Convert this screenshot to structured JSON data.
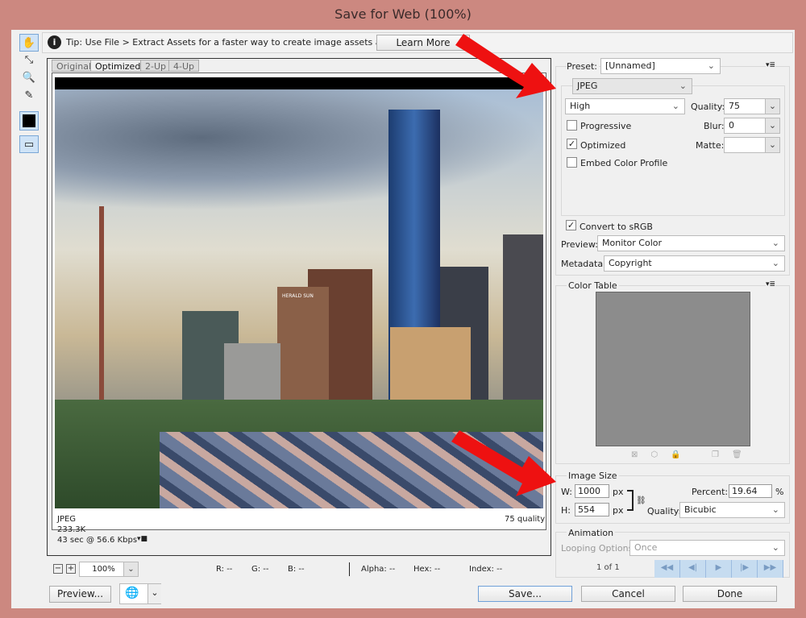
{
  "window": {
    "title": "Save for Web (100%)"
  },
  "tools": [
    {
      "name": "hand-tool",
      "glyph": "✋"
    },
    {
      "name": "slice-select-tool",
      "glyph": "⤡"
    },
    {
      "name": "zoom-tool",
      "glyph": "🔍"
    },
    {
      "name": "eyedropper-tool",
      "glyph": "✎"
    }
  ],
  "tip": {
    "text": "Tip: Use File > Extract Assets for a faster way to create image assets and SVG",
    "learn_more": "Learn More"
  },
  "tabs": [
    "Original",
    "Optimized",
    "2-Up",
    "4-Up"
  ],
  "active_tab": "Optimized",
  "preview_info": {
    "format": "JPEG",
    "size": "233.3K",
    "time": "43 sec @ 56.6 Kbps",
    "quality": "75 quality"
  },
  "photo_text": {
    "sign": "HERALD SUN"
  },
  "zoom": {
    "value": "100%"
  },
  "readout": {
    "r": "R: --",
    "g": "G: --",
    "b": "B: --",
    "alpha": "Alpha: --",
    "hex": "Hex: --",
    "index": "Index: --"
  },
  "settings": {
    "preset_label": "Preset:",
    "preset": "[Unnamed]",
    "format": "JPEG",
    "compression": "High",
    "quality_label": "Quality:",
    "quality": "75",
    "blur_label": "Blur:",
    "blur": "0",
    "matte_label": "Matte:",
    "matte": "",
    "progressive": {
      "label": "Progressive",
      "checked": false
    },
    "optimized": {
      "label": "Optimized",
      "checked": true
    },
    "embed_profile": {
      "label": "Embed Color Profile",
      "checked": false
    },
    "convert_srgb": {
      "label": "Convert to sRGB",
      "checked": true
    },
    "preview_label": "Preview:",
    "preview": "Monitor Color",
    "metadata_label": "Metadata:",
    "metadata": "Copyright"
  },
  "color_table": {
    "title": "Color Table"
  },
  "image_size": {
    "title": "Image Size",
    "w_label": "W:",
    "width": "1000",
    "h_label": "H:",
    "height": "554",
    "unit": "px",
    "percent_label": "Percent:",
    "percent": "19.64",
    "percent_unit": "%",
    "quality_label": "Quality:",
    "quality": "Bicubic"
  },
  "animation": {
    "title": "Animation",
    "looping_label": "Looping Options:",
    "looping": "Once",
    "frame": "1 of 1"
  },
  "buttons": {
    "preview": "Preview...",
    "save": "Save...",
    "cancel": "Cancel",
    "done": "Done"
  },
  "colors": {
    "title_bar": "#cc8880",
    "dialog_bg": "#f0f0f0",
    "arrow": "#ee1111"
  }
}
